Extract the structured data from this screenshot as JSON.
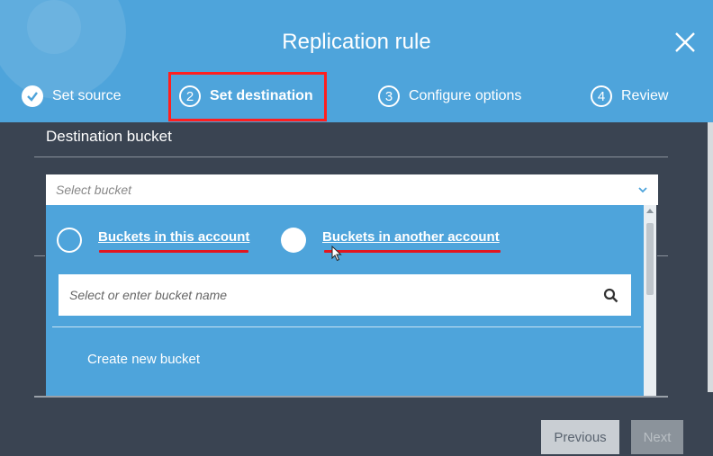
{
  "dialog": {
    "title": "Replication rule"
  },
  "steps": [
    {
      "number": "✓",
      "label": "Set source"
    },
    {
      "number": "2",
      "label": "Set destination"
    },
    {
      "number": "3",
      "label": "Configure options"
    },
    {
      "number": "4",
      "label": "Review"
    }
  ],
  "destination": {
    "label": "Destination bucket",
    "select_placeholder": "Select bucket",
    "options": {
      "this_account": "Buckets in this account",
      "another_account": "Buckets in another account"
    },
    "search_placeholder": "Select or enter bucket name",
    "create_label": "Create new bucket"
  },
  "footer": {
    "previous_label": "Previous",
    "next_label": "Next"
  },
  "colors": {
    "header": "#4ea4db",
    "background": "#3a4452",
    "highlight": "#ff1f1f"
  },
  "icons": [
    "close-icon",
    "check-icon",
    "chevron-down-icon",
    "search-icon",
    "mouse-cursor-icon"
  ]
}
